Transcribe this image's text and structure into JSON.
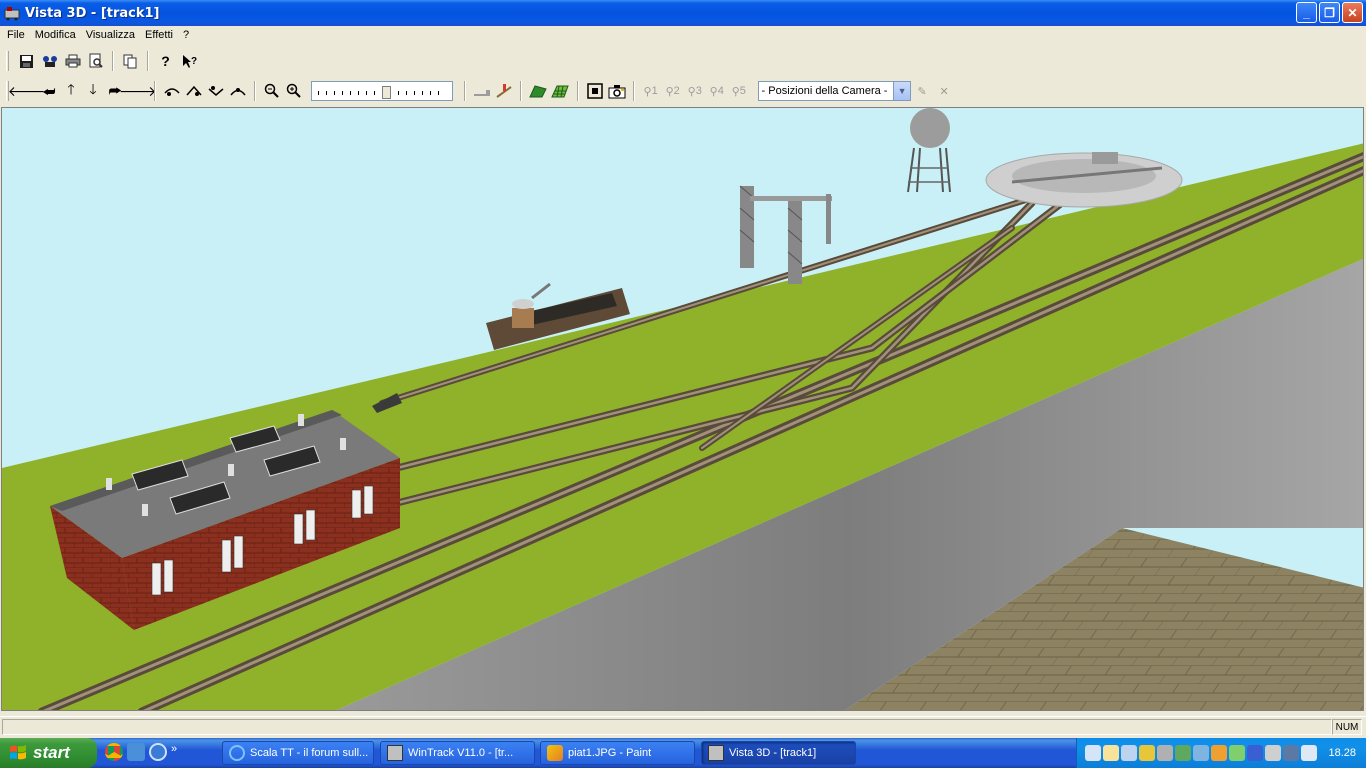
{
  "window": {
    "title": "Vista 3D - [track1]"
  },
  "menu": [
    "File",
    "Modifica",
    "Visualizza",
    "Effetti",
    "?"
  ],
  "toolbar1": {
    "icons": [
      "save-icon",
      "print-setup-icon",
      "print-icon",
      "print-preview-icon",
      "copy-icon",
      "help-icon",
      "context-help-icon"
    ]
  },
  "toolbar2": {
    "nav_icons": [
      "arrow-left-icon",
      "arrow-back-icon",
      "arrow-up-icon",
      "arrow-down-icon",
      "arrow-redo-icon",
      "arrow-right-icon"
    ],
    "view_icons": [
      "view-1-icon",
      "view-2-icon",
      "view-3-icon",
      "view-4-icon"
    ],
    "zoom_icons": [
      "zoom-out-icon",
      "zoom-in-icon"
    ],
    "zoom_level": 0.48,
    "render_icons": [
      "flat-icon",
      "signal-icon",
      "terrain-icon",
      "grid-icon",
      "fit-view-icon",
      "camera-icon"
    ],
    "camera_slots": [
      "1",
      "2",
      "3",
      "4",
      "5"
    ],
    "camera_select": "- Posizioni della Camera -"
  },
  "status": {
    "num": "NUM"
  },
  "taskbar": {
    "start": "start",
    "tasks": [
      {
        "label": "Scala TT - il forum sull...",
        "icon": "ie-icon"
      },
      {
        "label": "WinTrack  V11.0 - [tr...",
        "icon": "wintrack-icon"
      },
      {
        "label": "piat1.JPG - Paint",
        "icon": "paint-icon"
      },
      {
        "label": "Vista 3D - [track1]",
        "icon": "wintrack-icon"
      }
    ],
    "clock": "18.28"
  },
  "colors": {
    "grass": "#8fb22a",
    "sky": "#c8f0f6",
    "wall": "#8a8a8a",
    "brick": "#8b2f1f",
    "roof": "#6e6e6e",
    "track": "#8a7a66",
    "floor": "#8c8060"
  }
}
